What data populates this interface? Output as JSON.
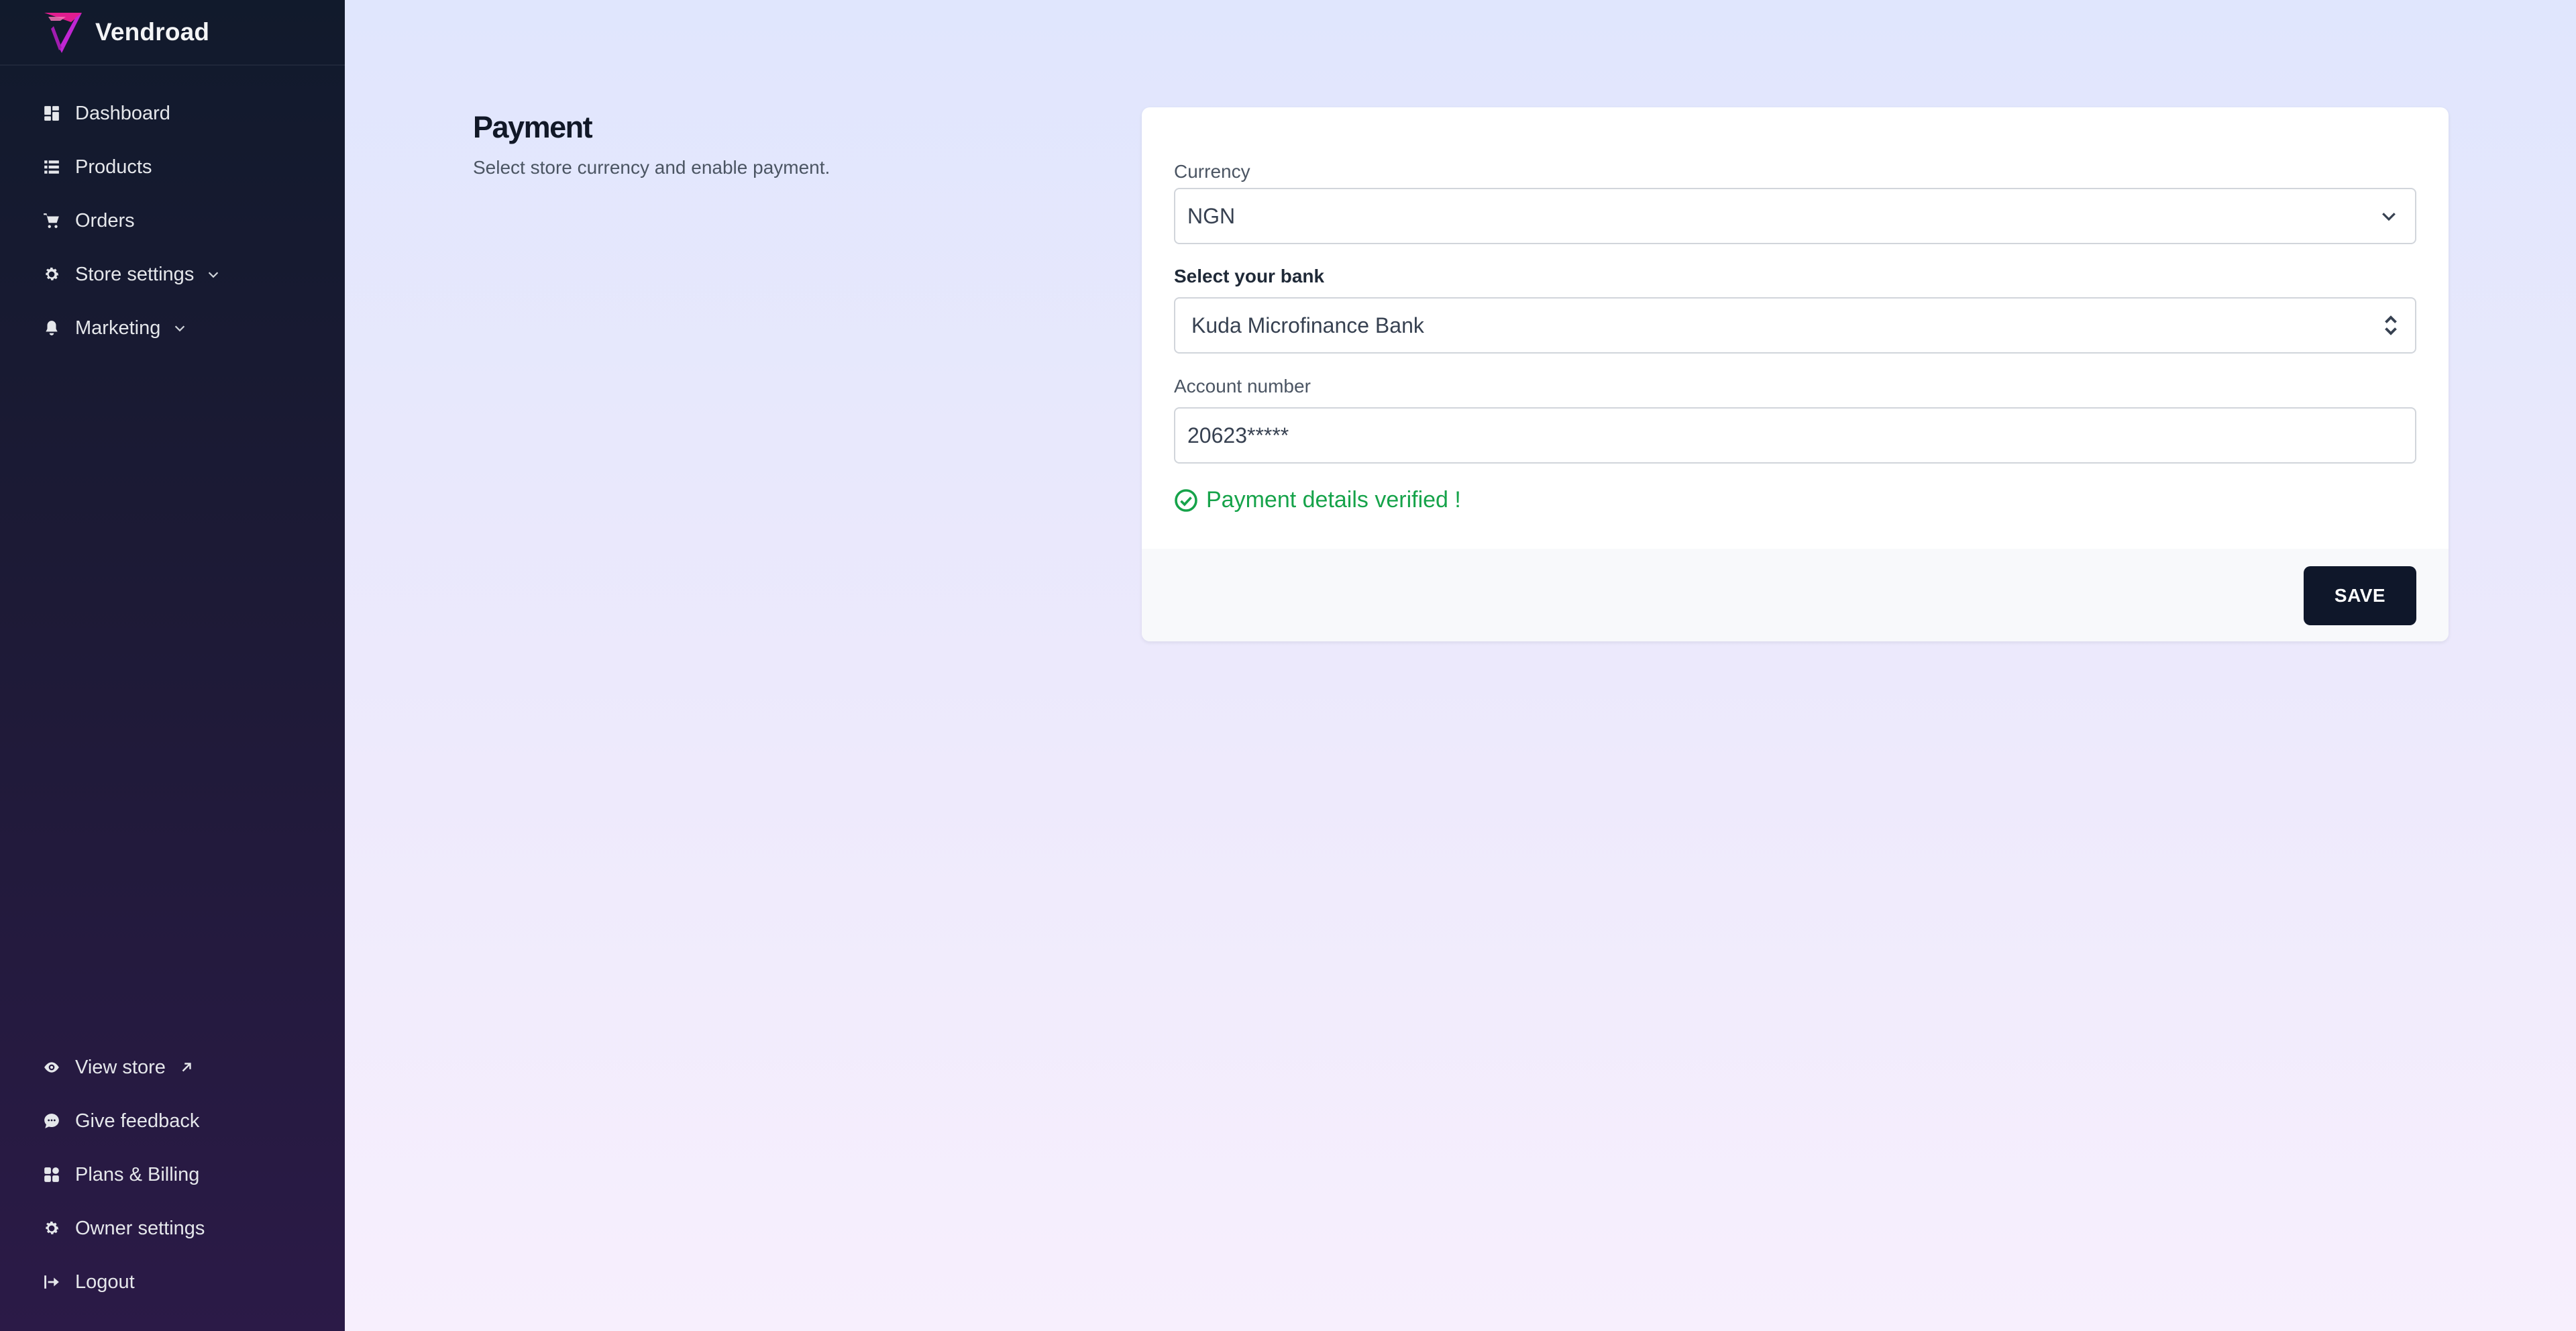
{
  "brand": {
    "name": "Vendroad"
  },
  "sidebar": {
    "top_items": [
      {
        "label": "Dashboard",
        "icon": "dashboard-icon"
      },
      {
        "label": "Products",
        "icon": "list-icon"
      },
      {
        "label": "Orders",
        "icon": "cart-icon"
      },
      {
        "label": "Store settings",
        "icon": "gear-icon",
        "expandable": true
      },
      {
        "label": "Marketing",
        "icon": "bell-icon",
        "expandable": true
      }
    ],
    "bottom_items": [
      {
        "label": "View store",
        "icon": "eye-icon",
        "external": true
      },
      {
        "label": "Give feedback",
        "icon": "chat-icon"
      },
      {
        "label": "Plans & Billing",
        "icon": "apps-icon"
      },
      {
        "label": "Owner settings",
        "icon": "gear-icon"
      },
      {
        "label": "Logout",
        "icon": "logout-icon"
      }
    ]
  },
  "section": {
    "title": "Payment",
    "description": "Select store currency and enable payment."
  },
  "form": {
    "currency_label": "Currency",
    "currency_value": "NGN",
    "bank_label": "Select your bank",
    "bank_value": "Kuda Microfinance Bank",
    "account_label": "Account number",
    "account_value": "20623*****",
    "verified_text": "Payment details verified !",
    "save_label": "SAVE"
  },
  "colors": {
    "sidebar_top": "#111a2c",
    "sidebar_bottom": "#2b1a47",
    "success": "#16a34a",
    "button": "#0f172a",
    "brand_accent": "#c026d3"
  }
}
